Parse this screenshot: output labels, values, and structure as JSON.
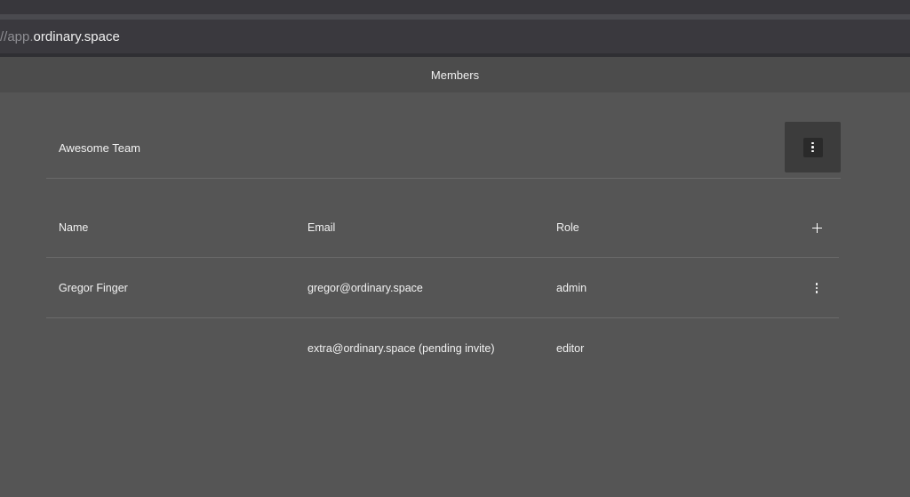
{
  "browser": {
    "url_prefix": "//app.",
    "url_domain": "ordinary.space"
  },
  "page": {
    "title": "Members"
  },
  "team": {
    "name": "Awesome Team",
    "menu_icon": "vertical-dots-icon"
  },
  "members_table": {
    "columns": [
      "Name",
      "Email",
      "Role"
    ],
    "add_icon": "plus-icon",
    "rows": [
      {
        "name": "Gregor Finger",
        "email": "gregor@ordinary.space",
        "role": "admin",
        "menu_icon": "vertical-dots-icon"
      },
      {
        "name": "",
        "email": "extra@ordinary.space (pending invite)",
        "role": "editor"
      }
    ]
  },
  "colors": {
    "background": "#555555",
    "header_bar": "#4c4c4c",
    "divider": "#6a6a6a",
    "menu_button": "#3c3c3c",
    "text": "#f2f2f2"
  }
}
